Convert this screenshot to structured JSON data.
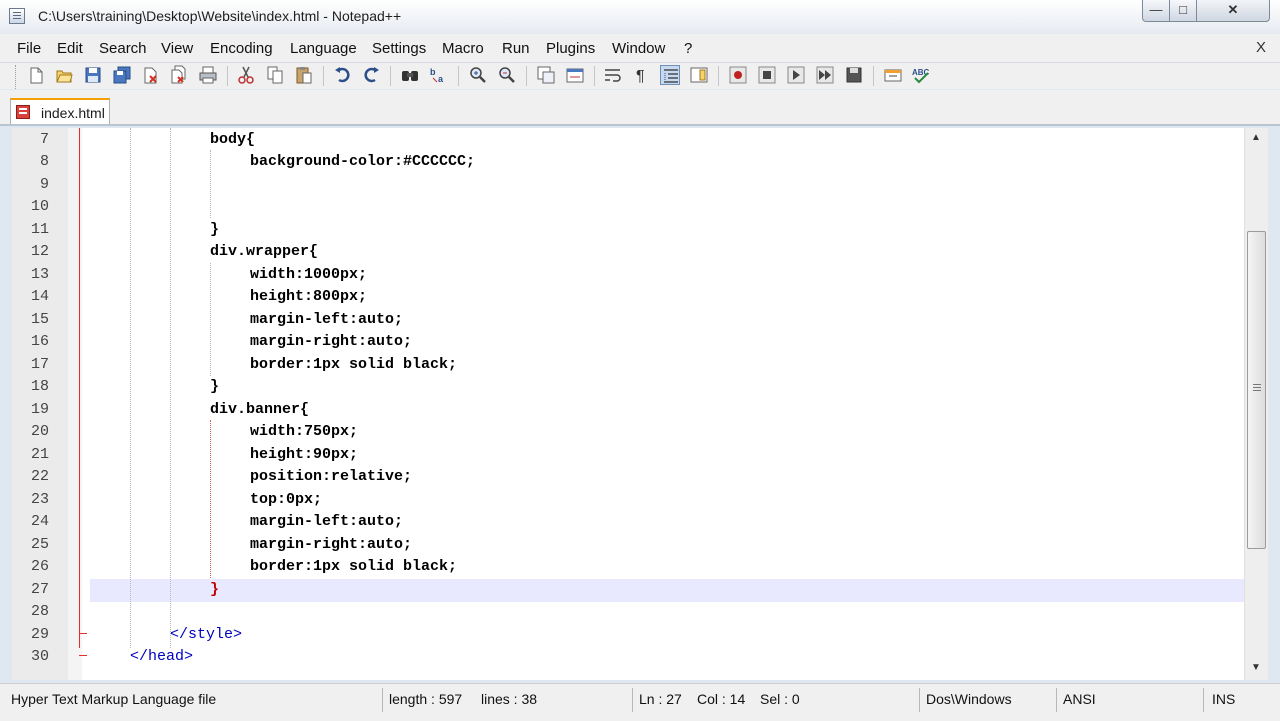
{
  "window": {
    "title": "C:\\Users\\training\\Desktop\\Website\\index.html - Notepad++",
    "controls": {
      "minimize": "—",
      "maximize": "□",
      "close": "✕"
    }
  },
  "menu": {
    "items": [
      "File",
      "Edit",
      "Search",
      "View",
      "Encoding",
      "Language",
      "Settings",
      "Macro",
      "Run",
      "Plugins",
      "Window",
      "?"
    ],
    "close": "X"
  },
  "toolbar": {
    "buttons": [
      "new-file-icon",
      "open-file-icon",
      "save-icon",
      "save-all-icon",
      "close-icon",
      "close-all-icon",
      "print-icon",
      "cut-icon",
      "copy-icon",
      "paste-icon",
      "undo-icon",
      "redo-icon",
      "find-icon",
      "replace-icon",
      "zoom-in-icon",
      "zoom-out-icon",
      "sync-vertical-icon",
      "sync-horizontal-icon",
      "word-wrap-icon",
      "show-all-chars-icon",
      "indent-guide-icon",
      "document-map-icon",
      "record-macro-icon",
      "stop-macro-icon",
      "play-macro-icon",
      "run-macro-multiple-icon",
      "save-macro-icon",
      "run-icon",
      "spellcheck-icon"
    ]
  },
  "tabs": [
    {
      "label": "index.html",
      "icon": "modified-file-icon"
    }
  ],
  "editor": {
    "lines": [
      {
        "n": "7",
        "text": "body{"
      },
      {
        "n": "8",
        "text": "background-color:#CCCCCC;"
      },
      {
        "n": "9",
        "text": ""
      },
      {
        "n": "10",
        "text": ""
      },
      {
        "n": "11",
        "text": "}"
      },
      {
        "n": "12",
        "text": "div.wrapper{"
      },
      {
        "n": "13",
        "text": "width:1000px;"
      },
      {
        "n": "14",
        "text": "height:800px;"
      },
      {
        "n": "15",
        "text": "margin-left:auto;"
      },
      {
        "n": "16",
        "text": "margin-right:auto;"
      },
      {
        "n": "17",
        "text": "border:1px solid black;"
      },
      {
        "n": "18",
        "text": "}"
      },
      {
        "n": "19",
        "text": "div.banner{"
      },
      {
        "n": "20",
        "text": "width:750px;"
      },
      {
        "n": "21",
        "text": "height:90px;"
      },
      {
        "n": "22",
        "text": "position:relative;"
      },
      {
        "n": "23",
        "text": "top:0px;"
      },
      {
        "n": "24",
        "text": "margin-left:auto;"
      },
      {
        "n": "25",
        "text": "margin-right:auto;"
      },
      {
        "n": "26",
        "text": "border:1px solid black;"
      },
      {
        "n": "27",
        "text": "}"
      },
      {
        "n": "28",
        "text": ""
      },
      {
        "n": "29",
        "text": "</style>"
      },
      {
        "n": "30",
        "text": "</head>"
      }
    ]
  },
  "status": {
    "file_type": "Hyper Text Markup Language file",
    "length": "length : 597",
    "lines": "lines : 38",
    "ln": "Ln : 27",
    "col": "Col : 14",
    "sel": "Sel : 0",
    "eol": "Dos\\Windows",
    "encoding": "ANSI",
    "mode": "INS"
  },
  "colors": {
    "accent_tab": "#f5a000",
    "brace_highlight": "#c00000",
    "caret_line": "#e8e8ff"
  }
}
